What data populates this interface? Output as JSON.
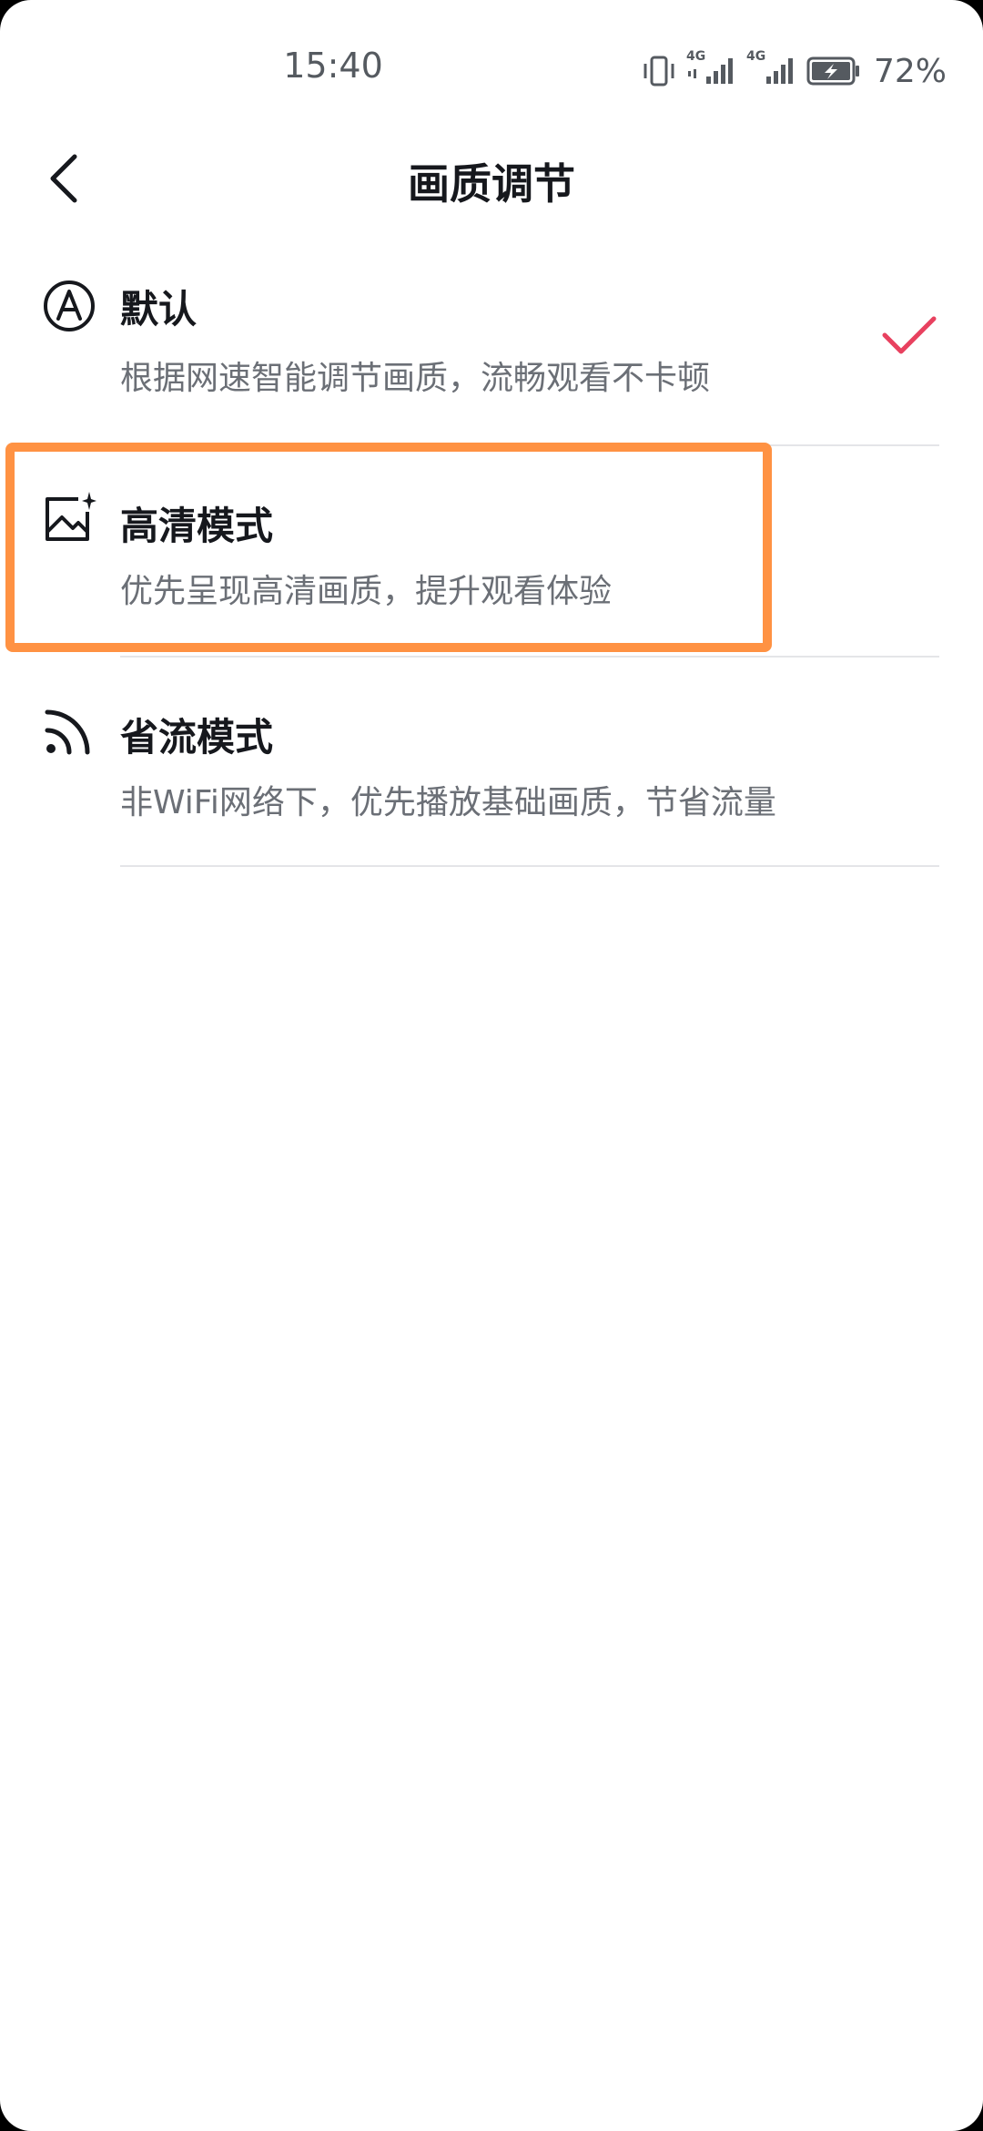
{
  "status_bar": {
    "time": "15:40",
    "battery_percent": "72%",
    "network_1": "4G",
    "network_2": "4G"
  },
  "header": {
    "title": "画质调节",
    "back_icon": "chevron-left-icon"
  },
  "options": [
    {
      "title": "默认",
      "description": "根据网速智能调节画质，流畅观看不卡顿",
      "icon": "auto-a-icon",
      "selected": true
    },
    {
      "title": "高清模式",
      "description": "优先呈现高清画质，提升观看体验",
      "icon": "image-sparkle-icon",
      "selected": false
    },
    {
      "title": "省流模式",
      "description": "非WiFi网络下，优先播放基础画质，节省流量",
      "icon": "signal-wave-icon",
      "selected": false
    }
  ],
  "colors": {
    "check": "#e8415f",
    "highlight": "#ff9243",
    "title_text": "#16181d",
    "desc_text": "#6b6f76"
  }
}
